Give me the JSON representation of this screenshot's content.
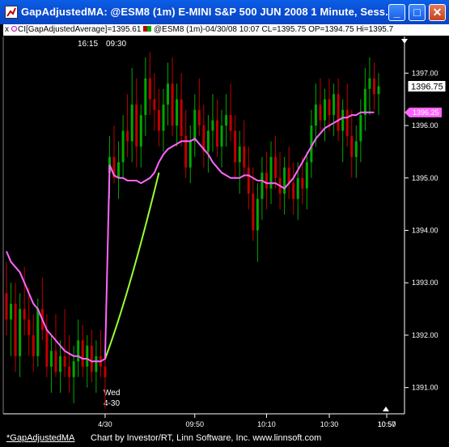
{
  "window": {
    "title": "GapAdjustedMA: @ESM8 (1m) E-MINI S&P 500 JUN 2008 1 Minute, Sess...",
    "buttons": {
      "minimize": "_",
      "maximize": "□",
      "close": "✕"
    }
  },
  "legend": {
    "close_box": "x",
    "study": "CI[GapAdjustedAverage]=1395.61",
    "symbol": "@ESM8 (1m)-04/30/08 10:07 CL=1395.75 OP=1394.75 Hi=1395.7",
    "study_color": "#ff66ff"
  },
  "chart_data": {
    "type": "candlestick",
    "instrument": "@ESM8 (1m) E-MINI S&P 500 JUN 2008",
    "y_ticks": [
      1391,
      1392,
      1393,
      1394,
      1395,
      1396,
      1397
    ],
    "y_tick_labels": [
      "1391.00",
      "1392.00",
      "1393.00",
      "1394.00",
      "1395.00",
      "1396.00",
      "1397.00"
    ],
    "ylim": [
      1390.5,
      1397.7
    ],
    "x_tick_labels": [
      "4/30",
      "09:50",
      "10:10",
      "10:30",
      "10:50",
      "10:57"
    ],
    "session_markers": [
      "16:15",
      "09:30"
    ],
    "date_marker": [
      "Wed",
      "4-30"
    ],
    "last_price_label": "1396.75",
    "ma_value_label": "1396.25",
    "colors": {
      "up": "#00a800",
      "down": "#c00000",
      "ma": "#ff66ff",
      "gap_line": "#99ff33",
      "axis": "#ffffff"
    },
    "candles": [
      [
        1392.8,
        1393.4,
        1392.0,
        1392.3
      ],
      [
        1392.3,
        1393.0,
        1391.6,
        1392.6
      ],
      [
        1392.6,
        1393.0,
        1391.3,
        1391.6
      ],
      [
        1391.6,
        1392.8,
        1391.2,
        1392.5
      ],
      [
        1392.5,
        1393.3,
        1392.0,
        1392.3
      ],
      [
        1392.3,
        1392.9,
        1391.6,
        1392.0
      ],
      [
        1392.0,
        1392.4,
        1391.3,
        1391.6
      ],
      [
        1391.6,
        1392.7,
        1391.4,
        1392.5
      ],
      [
        1392.5,
        1393.1,
        1391.9,
        1392.1
      ],
      [
        1392.1,
        1392.4,
        1391.2,
        1391.4
      ],
      [
        1391.4,
        1392.0,
        1390.9,
        1391.7
      ],
      [
        1391.7,
        1392.4,
        1391.2,
        1391.3
      ],
      [
        1391.3,
        1391.9,
        1390.9,
        1391.6
      ],
      [
        1391.6,
        1392.5,
        1391.2,
        1391.4
      ],
      [
        1391.4,
        1392.0,
        1390.9,
        1391.2
      ],
      [
        1391.2,
        1391.8,
        1390.7,
        1391.5
      ],
      [
        1391.5,
        1392.3,
        1391.2,
        1391.9
      ],
      [
        1391.9,
        1392.2,
        1391.2,
        1391.4
      ],
      [
        1391.4,
        1392.0,
        1391.0,
        1391.8
      ],
      [
        1391.8,
        1392.1,
        1391.1,
        1391.3
      ],
      [
        1391.3,
        1391.9,
        1390.9,
        1391.6
      ],
      [
        1391.6,
        1392.1,
        1391.2,
        1391.4
      ],
      [
        1391.4,
        1391.7,
        1390.6,
        1391.2
      ],
      [
        1395.1,
        1395.8,
        1394.6,
        1395.4
      ],
      [
        1395.4,
        1396.0,
        1394.9,
        1395.0
      ],
      [
        1395.0,
        1395.7,
        1394.6,
        1395.3
      ],
      [
        1395.3,
        1396.2,
        1395.0,
        1395.9
      ],
      [
        1395.9,
        1396.6,
        1395.4,
        1395.7
      ],
      [
        1395.7,
        1397.1,
        1395.3,
        1396.4
      ],
      [
        1396.4,
        1396.9,
        1395.2,
        1395.6
      ],
      [
        1395.6,
        1396.4,
        1395.2,
        1396.2
      ],
      [
        1396.2,
        1397.3,
        1395.8,
        1396.9
      ],
      [
        1396.9,
        1397.4,
        1396.2,
        1396.5
      ],
      [
        1396.5,
        1397.0,
        1395.9,
        1396.3
      ],
      [
        1396.3,
        1396.7,
        1395.6,
        1395.9
      ],
      [
        1395.9,
        1396.7,
        1395.5,
        1396.4
      ],
      [
        1396.4,
        1397.2,
        1396.0,
        1396.8
      ],
      [
        1396.8,
        1397.3,
        1395.8,
        1396.0
      ],
      [
        1396.0,
        1396.8,
        1395.6,
        1396.5
      ],
      [
        1396.5,
        1397.0,
        1395.6,
        1395.8
      ],
      [
        1395.8,
        1396.3,
        1395.0,
        1395.2
      ],
      [
        1395.2,
        1396.0,
        1394.9,
        1395.7
      ],
      [
        1395.7,
        1396.6,
        1395.4,
        1396.3
      ],
      [
        1396.3,
        1396.9,
        1395.8,
        1396.0
      ],
      [
        1396.0,
        1396.4,
        1395.2,
        1395.5
      ],
      [
        1395.5,
        1396.2,
        1395.1,
        1395.9
      ],
      [
        1395.9,
        1396.6,
        1395.5,
        1396.1
      ],
      [
        1396.1,
        1396.5,
        1395.4,
        1395.6
      ],
      [
        1395.6,
        1396.3,
        1395.2,
        1396.0
      ],
      [
        1396.0,
        1396.6,
        1395.6,
        1396.2
      ],
      [
        1396.2,
        1396.8,
        1395.7,
        1395.9
      ],
      [
        1395.9,
        1396.2,
        1395.0,
        1395.3
      ],
      [
        1395.3,
        1395.9,
        1394.7,
        1395.6
      ],
      [
        1395.6,
        1396.1,
        1395.0,
        1395.2
      ],
      [
        1395.2,
        1395.6,
        1394.4,
        1394.7
      ],
      [
        1394.7,
        1395.2,
        1393.8,
        1394.0
      ],
      [
        1394.0,
        1394.9,
        1393.4,
        1394.6
      ],
      [
        1394.6,
        1395.4,
        1394.2,
        1395.1
      ],
      [
        1395.1,
        1395.5,
        1394.4,
        1394.8
      ],
      [
        1394.8,
        1395.7,
        1394.5,
        1395.4
      ],
      [
        1395.4,
        1395.8,
        1394.8,
        1395.0
      ],
      [
        1395.0,
        1395.5,
        1394.4,
        1394.7
      ],
      [
        1394.7,
        1395.4,
        1394.3,
        1395.2
      ],
      [
        1395.2,
        1395.6,
        1394.6,
        1394.9
      ],
      [
        1394.9,
        1395.3,
        1394.3,
        1394.6
      ],
      [
        1394.6,
        1395.3,
        1394.2,
        1395.0
      ],
      [
        1395.0,
        1395.4,
        1394.5,
        1394.8
      ],
      [
        1394.8,
        1395.5,
        1394.4,
        1395.3
      ],
      [
        1395.3,
        1396.3,
        1395.0,
        1396.0
      ],
      [
        1396.0,
        1396.8,
        1395.6,
        1396.4
      ],
      [
        1396.4,
        1396.9,
        1395.9,
        1396.1
      ],
      [
        1396.1,
        1396.7,
        1395.7,
        1396.5
      ],
      [
        1396.5,
        1396.9,
        1395.9,
        1396.2
      ],
      [
        1396.2,
        1396.8,
        1395.8,
        1396.6
      ],
      [
        1396.6,
        1396.9,
        1395.7,
        1395.9
      ],
      [
        1395.9,
        1396.5,
        1395.3,
        1396.3
      ],
      [
        1396.3,
        1396.8,
        1395.6,
        1395.8
      ],
      [
        1395.8,
        1396.3,
        1395.0,
        1395.4
      ],
      [
        1395.4,
        1396.0,
        1395.0,
        1395.7
      ],
      [
        1395.7,
        1396.5,
        1395.3,
        1396.2
      ],
      [
        1396.2,
        1397.1,
        1395.9,
        1396.7
      ],
      [
        1396.7,
        1397.3,
        1396.2,
        1396.9
      ],
      [
        1396.9,
        1397.2,
        1396.3,
        1396.6
      ],
      [
        1396.6,
        1397.0,
        1396.2,
        1396.75
      ]
    ],
    "ma": [
      1393.6,
      1393.4,
      1393.3,
      1393.2,
      1393.0,
      1392.8,
      1392.6,
      1392.5,
      1392.3,
      1392.1,
      1392.0,
      1391.9,
      1391.8,
      1391.7,
      1391.65,
      1391.6,
      1391.6,
      1391.55,
      1391.55,
      1391.5,
      1391.5,
      1391.5,
      1391.55,
      1395.25,
      1395.05,
      1395.0,
      1395.0,
      1394.95,
      1394.95,
      1394.95,
      1394.9,
      1394.95,
      1395.0,
      1395.1,
      1395.3,
      1395.45,
      1395.55,
      1395.6,
      1395.65,
      1395.7,
      1395.7,
      1395.7,
      1395.75,
      1395.65,
      1395.55,
      1395.45,
      1395.3,
      1395.2,
      1395.1,
      1395.05,
      1395.0,
      1395.0,
      1395.0,
      1395.05,
      1395.05,
      1395.0,
      1394.95,
      1394.95,
      1394.9,
      1394.9,
      1394.9,
      1394.85,
      1394.8,
      1394.9,
      1395.0,
      1395.15,
      1395.3,
      1395.45,
      1395.6,
      1395.75,
      1395.85,
      1395.95,
      1396.0,
      1396.05,
      1396.1,
      1396.15,
      1396.15,
      1396.2,
      1396.2,
      1396.25,
      1396.25,
      1396.25,
      1396.25
    ],
    "gap_line": [
      [
        22,
        1391.55
      ],
      [
        34,
        1395.1
      ]
    ]
  },
  "footer": {
    "tab": "*GapAdjustedMA",
    "credit": "Chart by Investor/RT, Linn Software, Inc. www.linnsoft.com"
  }
}
